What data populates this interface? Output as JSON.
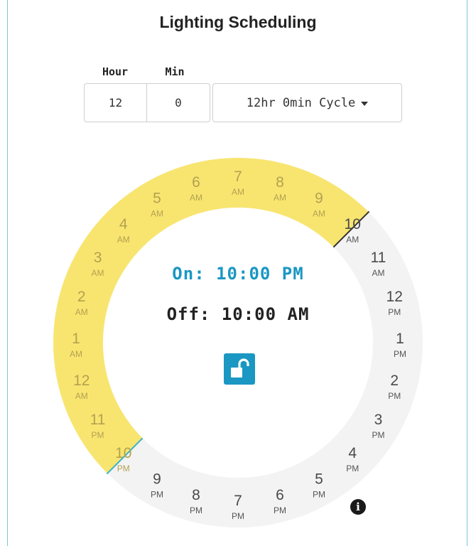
{
  "title": "Lighting Scheduling",
  "duration": {
    "hour_label": "Hour",
    "min_label": "Min",
    "hour_value": "12",
    "min_value": "0",
    "cycle_label": "12hr 0min Cycle"
  },
  "dial": {
    "hour_labels": [
      {
        "num": "12",
        "period": "AM"
      },
      {
        "num": "1",
        "period": "AM"
      },
      {
        "num": "2",
        "period": "AM"
      },
      {
        "num": "3",
        "period": "AM"
      },
      {
        "num": "4",
        "period": "AM"
      },
      {
        "num": "5",
        "period": "AM"
      },
      {
        "num": "6",
        "period": "AM"
      },
      {
        "num": "7",
        "period": "AM"
      },
      {
        "num": "8",
        "period": "AM"
      },
      {
        "num": "9",
        "period": "AM"
      },
      {
        "num": "10",
        "period": "AM"
      },
      {
        "num": "11",
        "period": "AM"
      },
      {
        "num": "12",
        "period": "PM"
      },
      {
        "num": "1",
        "period": "PM"
      },
      {
        "num": "2",
        "period": "PM"
      },
      {
        "num": "3",
        "period": "PM"
      },
      {
        "num": "4",
        "period": "PM"
      },
      {
        "num": "5",
        "period": "PM"
      },
      {
        "num": "6",
        "period": "PM"
      },
      {
        "num": "7",
        "period": "PM"
      },
      {
        "num": "8",
        "period": "PM"
      },
      {
        "num": "9",
        "period": "PM"
      },
      {
        "num": "10",
        "period": "PM"
      },
      {
        "num": "11",
        "period": "PM"
      }
    ],
    "on_hour": 22,
    "off_hour": 10,
    "on_text": "On: 10:00 PM",
    "off_text": "Off: 10:00 AM",
    "lock_icon": "unlock-icon",
    "info_icon": "info-icon"
  },
  "colors": {
    "on_arc": "#f8e570",
    "off_arc": "#f3f3f3",
    "on_accent": "#1a97c2",
    "off_text": "#222222",
    "on_marker": "#3bb3c8",
    "off_marker": "#333333"
  }
}
